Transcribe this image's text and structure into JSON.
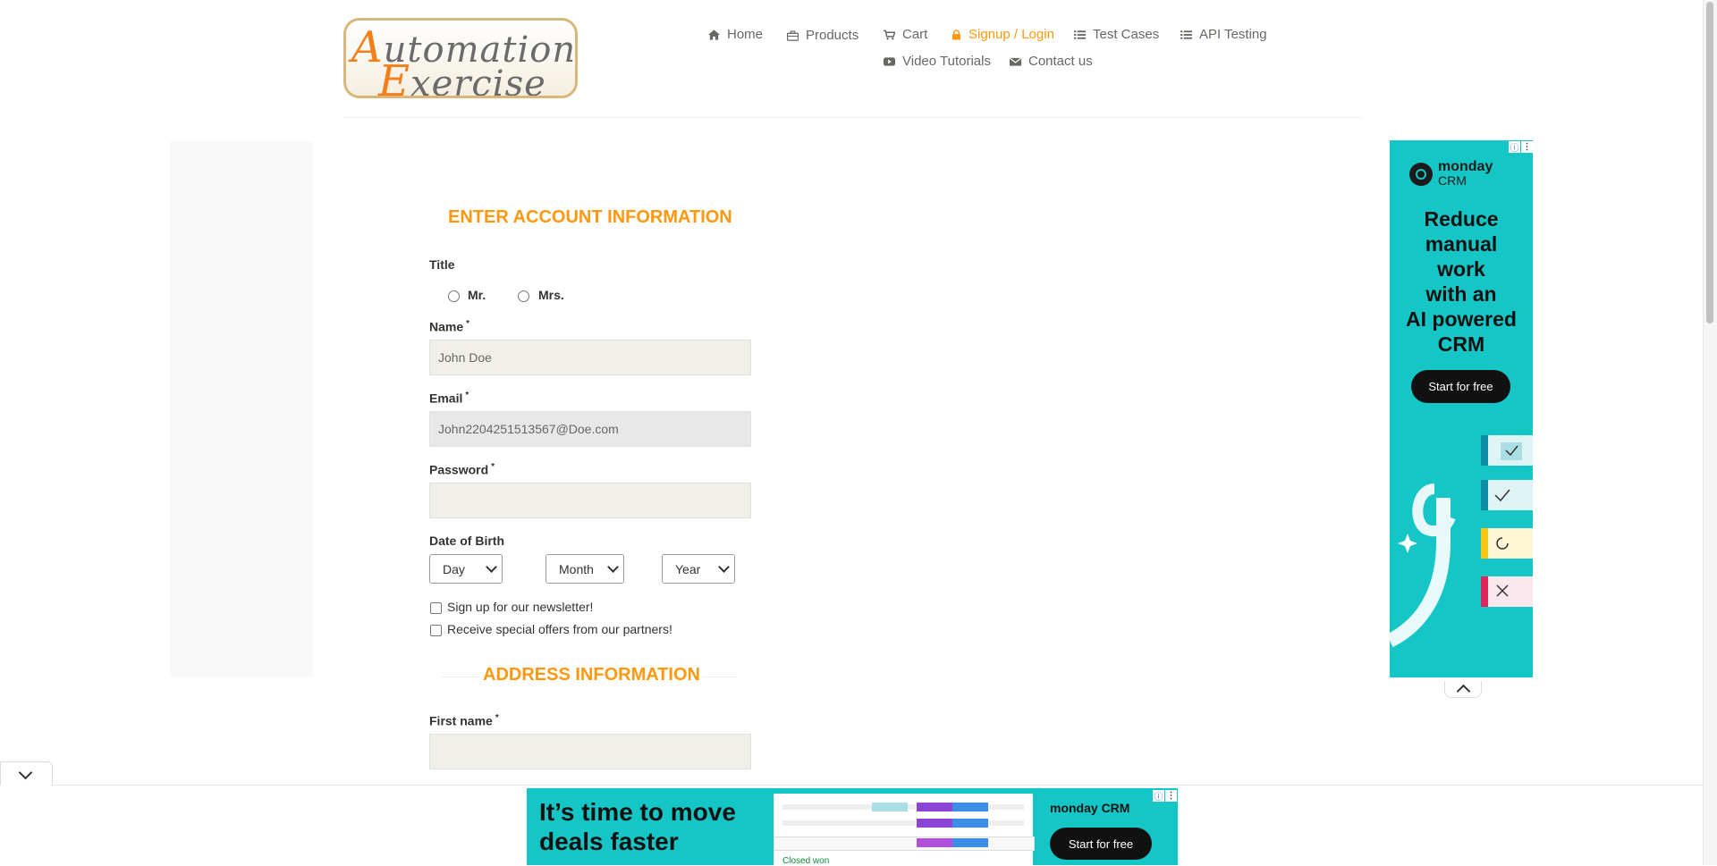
{
  "logo": {
    "line1_initial": "A",
    "line1_rest": "utomation",
    "line2_initial": "E",
    "line2_rest": "xercise"
  },
  "nav": {
    "items": [
      {
        "label": "Home",
        "icon": "home-icon"
      },
      {
        "label": "Products",
        "icon": "briefcase-icon"
      },
      {
        "label": "Cart",
        "icon": "cart-icon"
      },
      {
        "label": "Signup / Login",
        "icon": "lock-icon",
        "active": true
      },
      {
        "label": "Test Cases",
        "icon": "list-icon"
      },
      {
        "label": "API Testing",
        "icon": "list-icon"
      },
      {
        "label": "Video Tutorials",
        "icon": "youtube-icon"
      },
      {
        "label": "Contact us",
        "icon": "envelope-icon"
      }
    ],
    "active_color": "#fe980f"
  },
  "form": {
    "heading": "ENTER ACCOUNT INFORMATION",
    "title_label": "Title",
    "title_options": [
      "Mr.",
      "Mrs."
    ],
    "name_label": "Name",
    "name_value": "John Doe",
    "email_label": "Email",
    "email_value": "John2204251513567@Doe.com",
    "password_label": "Password",
    "password_value": "",
    "dob_label": "Date of Birth",
    "dob_day": "Day",
    "dob_month": "Month",
    "dob_year": "Year",
    "newsletter_label": "Sign up for our newsletter!",
    "offers_label": "Receive special offers from our partners!",
    "address_heading": "ADDRESS INFORMATION",
    "first_name_label": "First name",
    "first_name_value": "",
    "required_mark": "*"
  },
  "ads": {
    "right": {
      "brand": "monday",
      "brand_sub": "CRM",
      "headline": [
        "Reduce",
        "manual",
        "work",
        "with an",
        "AI powered",
        "CRM"
      ],
      "cta": "Start for free",
      "bg_color": "#14c6c6"
    },
    "bottom": {
      "headline_line1": "It’s time to move",
      "headline_line2": "deals faster",
      "brand": "monday CRM",
      "cta": "Start for free",
      "closed_won": "Closed won"
    }
  }
}
